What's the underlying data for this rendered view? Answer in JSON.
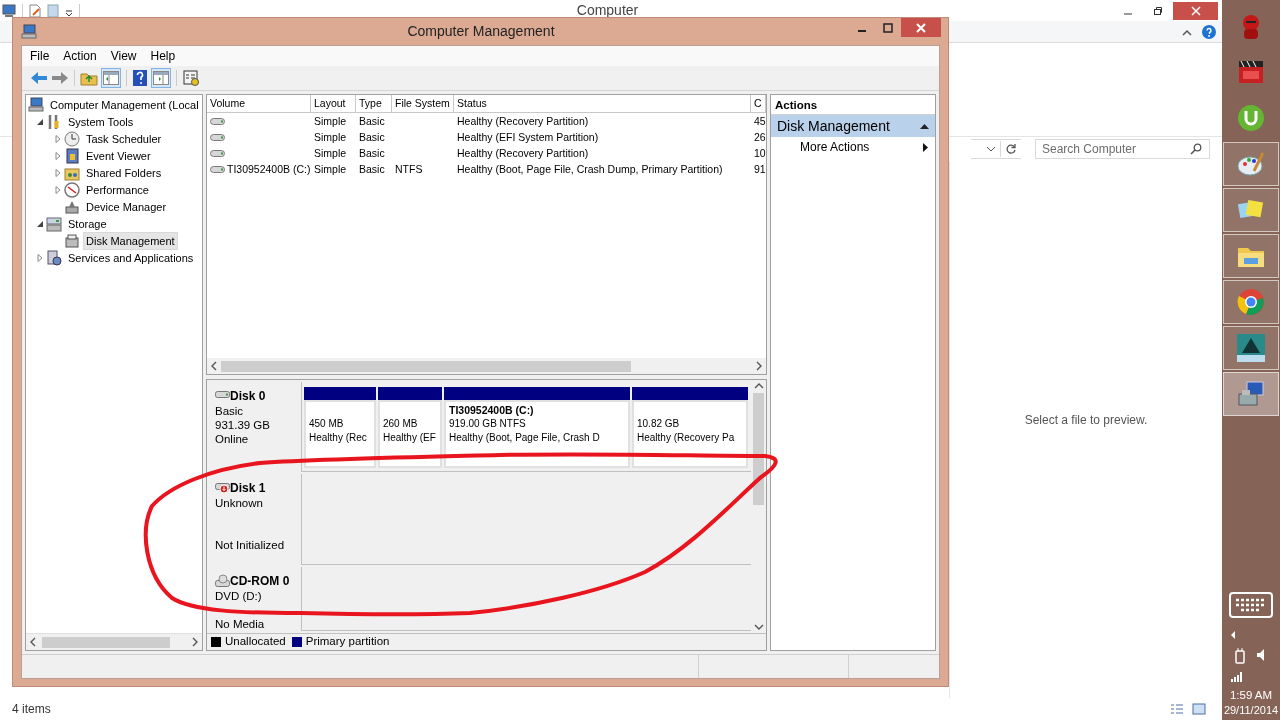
{
  "explorer": {
    "title": "Computer",
    "search": {
      "placeholder": "Search Computer"
    },
    "preview_message": "Select a file to preview.",
    "status": "4 items"
  },
  "window": {
    "title": "Computer Management",
    "menu": [
      "File",
      "Action",
      "View",
      "Help"
    ]
  },
  "tree": {
    "root": {
      "label": "Computer Management (Local"
    },
    "items": [
      {
        "label": "System Tools",
        "expanded": true,
        "selected": false,
        "children": [
          {
            "label": "Task Scheduler",
            "expanded": false,
            "selected": false
          },
          {
            "label": "Event Viewer",
            "expanded": false,
            "selected": false
          },
          {
            "label": "Shared Folders",
            "expanded": false,
            "selected": false
          },
          {
            "label": "Performance",
            "expanded": false,
            "selected": false
          },
          {
            "label": "Device Manager",
            "selected": false
          }
        ]
      },
      {
        "label": "Storage",
        "expanded": true,
        "selected": false,
        "children": [
          {
            "label": "Disk Management",
            "selected": true
          }
        ]
      },
      {
        "label": "Services and Applications",
        "expanded": false,
        "selected": false
      }
    ]
  },
  "volume_table": {
    "columns": [
      "Volume",
      "Layout",
      "Type",
      "File System",
      "Status",
      "C"
    ],
    "rows": [
      [
        "",
        "Simple",
        "Basic",
        "",
        "Healthy (Recovery Partition)",
        "45"
      ],
      [
        "",
        "Simple",
        "Basic",
        "",
        "Healthy (EFI System Partition)",
        "26"
      ],
      [
        "",
        "Simple",
        "Basic",
        "",
        "Healthy (Recovery Partition)",
        "10"
      ],
      [
        "TI30952400B (C:)",
        "Simple",
        "Basic",
        "NTFS",
        "Healthy (Boot, Page File, Crash Dump, Primary Partition)",
        "91"
      ]
    ]
  },
  "disks": [
    {
      "name": "Disk 0",
      "kind": "disk",
      "type": "Basic",
      "size": "931.39 GB",
      "status": "Online",
      "partitions": [
        {
          "size": "450 MB",
          "status": "Healthy (Rec"
        },
        {
          "size": "260 MB",
          "status": "Healthy (EF"
        },
        {
          "name": "TI30952400B  (C:)",
          "size": "919.00 GB NTFS",
          "status": "Healthy (Boot, Page File, Crash D"
        },
        {
          "size": "10.82 GB",
          "status": "Healthy (Recovery Pa"
        }
      ]
    },
    {
      "name": "Disk 1",
      "kind": "unknown",
      "type": "Unknown",
      "status": "Not Initialized"
    },
    {
      "name": "CD-ROM 0",
      "kind": "cdrom",
      "type": "DVD (D:)",
      "status": "No Media"
    }
  ],
  "legend": [
    {
      "label": "Unallocated",
      "color": "#000000"
    },
    {
      "label": "Primary partition",
      "color": "#000080"
    }
  ],
  "actions": {
    "title": "Actions",
    "section": "Disk Management",
    "items": [
      "More Actions"
    ]
  },
  "taskbar": {
    "apps": [
      {
        "running": false,
        "selected": false
      },
      {
        "running": false,
        "selected": false
      },
      {
        "running": false,
        "selected": false
      },
      {
        "running": true,
        "selected": false
      },
      {
        "running": true,
        "selected": false
      },
      {
        "running": true,
        "selected": false
      },
      {
        "running": true,
        "selected": false
      },
      {
        "running": true,
        "selected": false
      },
      {
        "running": true,
        "selected": true
      }
    ],
    "time": "1:59 AM",
    "date": "29/11/2014"
  }
}
